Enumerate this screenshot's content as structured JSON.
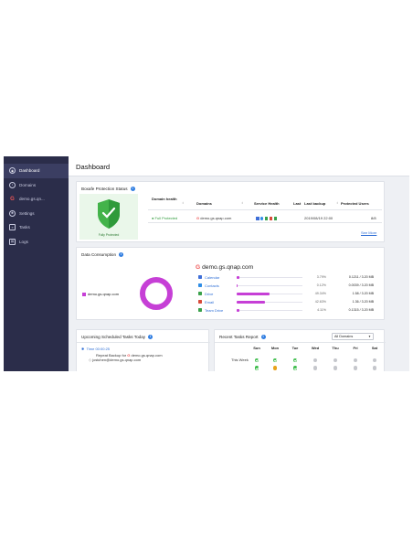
{
  "sidebar": {
    "items": [
      {
        "label": "Dashboard",
        "icon": "dashboard-icon"
      },
      {
        "label": "Domains",
        "icon": "domains-icon"
      },
      {
        "label": "demo.gs.qn...",
        "icon": "google-icon"
      },
      {
        "label": "Settings",
        "icon": "gear-icon"
      },
      {
        "label": "Tasks",
        "icon": "tasks-icon"
      },
      {
        "label": "Logs",
        "icon": "logs-icon"
      }
    ]
  },
  "header": {
    "title": "Dashboard"
  },
  "protection": {
    "title": "Boxafe Protection Status",
    "badge_label": "Fully Protected",
    "columns": [
      "Domain health",
      "Domains",
      "Service Health",
      "Last",
      "Last backup",
      "Protected Users"
    ],
    "row": {
      "health": "Full Protected",
      "domain": "demo.gs.qnap.com",
      "last_backup": "2019/08/19 22:00",
      "protected_users": "8/8"
    },
    "see_more": "See More"
  },
  "consumption": {
    "title": "Data Consumption",
    "legend_label": "demo.gs.qnap.com",
    "domain_title": "demo.gs.qnap.com",
    "apps": [
      {
        "name": "Calendar",
        "pct_text": "3.79%",
        "pct": 3.79,
        "size": "0.1211 / 3.20 MB",
        "color": "#3f6fd8"
      },
      {
        "name": "Contacts",
        "pct_text": "0.12%",
        "pct": 0.12,
        "size": "0.0039 / 3.20 MB",
        "color": "#2f8de6"
      },
      {
        "name": "Drive",
        "pct_text": "49.34%",
        "pct": 49.34,
        "size": "1.58 / 3.20 MB",
        "color": "#3aa14b"
      },
      {
        "name": "Email",
        "pct_text": "42.63%",
        "pct": 42.63,
        "size": "1.36 / 3.20 MB",
        "color": "#d84a3a"
      },
      {
        "name": "Team Drive",
        "pct_text": "4.11%",
        "pct": 4.11,
        "size": "0.1315 / 3.20 MB",
        "color": "#3aa14b"
      }
    ]
  },
  "upcoming": {
    "title": "Upcoming Scheduled Tasks Today",
    "time_label": "Time 00:00:25",
    "task_prefix": "Repeat Backup for",
    "task_domain": "demo.gs.qnap.com",
    "task_user": "jostchen@demo.gs.qnap.com"
  },
  "recent": {
    "title": "Recent Tasks Report",
    "filter": "All Domains",
    "days": [
      "Sun",
      "Mon",
      "Tue",
      "Wed",
      "Thu",
      "Fri",
      "Sat"
    ],
    "row_label": "This Week",
    "row1_status": [
      "ok",
      "ok",
      "ok",
      "none",
      "none",
      "none",
      "none"
    ],
    "row2_status": [
      "ok",
      "warn",
      "ok",
      "none",
      "none",
      "none",
      "none"
    ]
  }
}
